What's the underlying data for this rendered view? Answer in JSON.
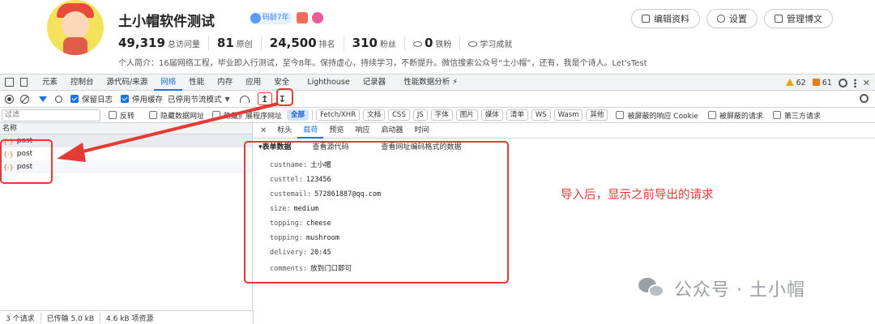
{
  "profile": {
    "username": "土小帽软件测试",
    "badge_age": "码龄7年",
    "stats": [
      {
        "num": "49,319",
        "label": "总访问量"
      },
      {
        "num": "81",
        "label": "原创"
      },
      {
        "num": "24,500",
        "label": "排名"
      },
      {
        "num": "310",
        "label": "粉丝"
      },
      {
        "num": "0",
        "label": "铁粉"
      }
    ],
    "achievements": "学习成就",
    "bio": "个人简介：16届网络工程，毕业即入行测试，至今8年。保持虚心，持续学习，不断提升。微信搜索公众号“土小帽”，还有，我是个诗人。Let'sTest",
    "buttons": [
      "编辑资料",
      "设置",
      "管理博文"
    ]
  },
  "devtools": {
    "tabs": [
      "元素",
      "控制台",
      "源代码/来源",
      "网络",
      "性能",
      "内存",
      "应用",
      "安全",
      "Lighthouse",
      "记录器",
      "性能数据分析 ⚡"
    ],
    "active_tab": "网络",
    "warnings": "62",
    "errors": "61",
    "toolbar": {
      "preserve_log": "保留日志",
      "disable_cache": "停用缓存",
      "throttle": "已停用节流模式"
    },
    "filter": {
      "placeholder": "过滤",
      "invert": "反转",
      "hide_data_urls": "隐藏数据网址",
      "hide_ext_urls": "隐藏扩展程序网址",
      "types": [
        "全部",
        "Fetch/XHR",
        "文档",
        "CSS",
        "JS",
        "字体",
        "图片",
        "媒体",
        "清单",
        "WS",
        "Wasm",
        "其他"
      ],
      "active_type": "全部",
      "blocked_cookies": "被屏蔽的响应 Cookie",
      "blocked_requests": "被屏蔽的请求",
      "third_party": "第三方请求"
    },
    "request_list": {
      "header": "名称",
      "items": [
        "post",
        "post",
        "post"
      ]
    },
    "detail_tabs": [
      "标头",
      "载荷",
      "预览",
      "响应",
      "启动器",
      "时间"
    ],
    "active_detail_tab": "载荷",
    "payload": {
      "section_title": "▾表单数据",
      "view_source": "查看源代码",
      "view_url_encoded": "查看网址编码格式的数据",
      "fields": [
        {
          "key": "custname:",
          "value": "土小帽"
        },
        {
          "key": "custtel:",
          "value": "123456"
        },
        {
          "key": "custemail:",
          "value": "572861887@qq.com"
        },
        {
          "key": "size:",
          "value": "medium"
        },
        {
          "key": "topping:",
          "value": "cheese"
        },
        {
          "key": "topping:",
          "value": "mushroom"
        },
        {
          "key": "delivery:",
          "value": "20:45"
        },
        {
          "key": "comments:",
          "value": "放到门口即可"
        }
      ]
    },
    "status": [
      "3 个请求",
      "已传输 5.0 kB",
      "4.6 kB 项资源"
    ]
  },
  "annotation": {
    "text": "导入后，显示之前导出的请求",
    "color": "#e53935"
  },
  "watermark": "公众号 · 土小帽"
}
